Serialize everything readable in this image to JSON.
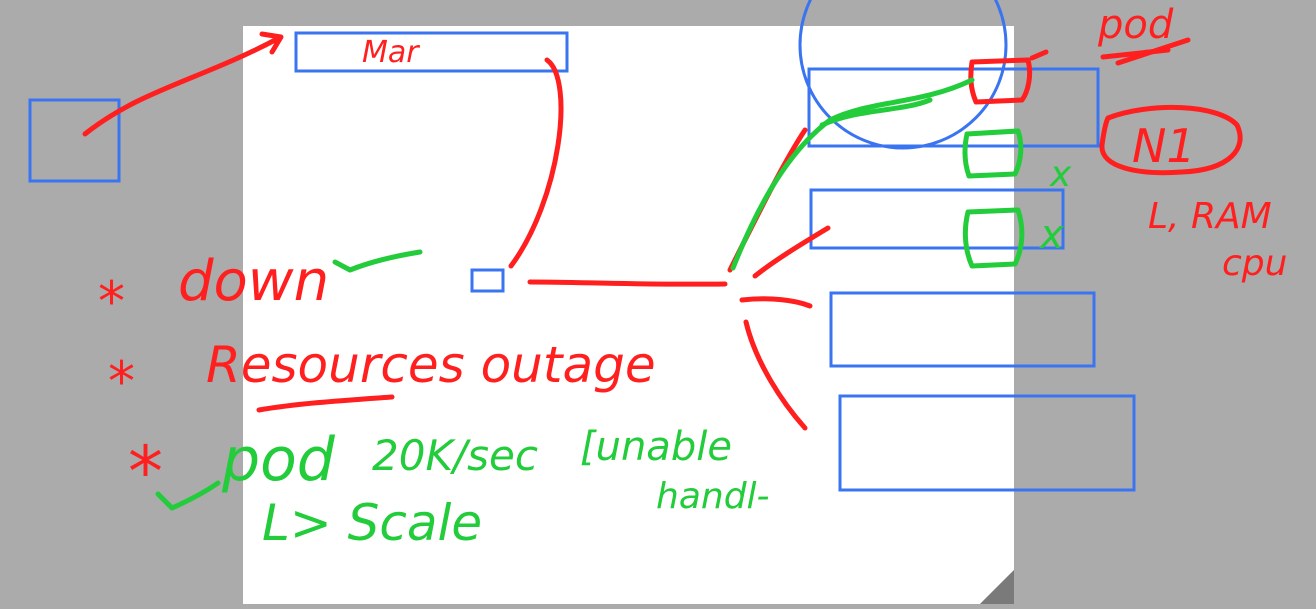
{
  "colors": {
    "background": "#ababab",
    "page": "#ffffff",
    "page_fold": "#7a7a7a",
    "box_stroke": "#3b74f0",
    "ink_red": "#ff1f1f",
    "ink_green": "#22cc3a"
  },
  "labels": {
    "top_box": "Mar",
    "pod_top": "pod",
    "node_box": "N1",
    "node_resources_1": "L, RAM",
    "node_resources_2": "cpu",
    "cross_1": "x",
    "cross_2": "x"
  },
  "notes": {
    "bullet_star": "*",
    "down": "down",
    "resources": "Resources outage",
    "pod": "pod",
    "rate": "20K/sec",
    "unable": "[unable",
    "handle": "handl-",
    "scale": "L> Scale"
  }
}
